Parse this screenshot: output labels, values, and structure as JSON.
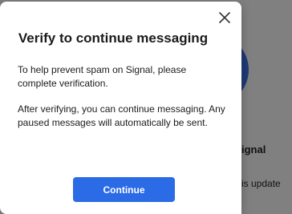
{
  "background": {
    "heading_partial": "ignal",
    "text_partial": "is update"
  },
  "dialog": {
    "title": "Verify to continue messaging",
    "paragraph1": "To help prevent spam on Signal, please complete verification.",
    "paragraph2": "After verifying, you can continue messaging. Any paused messages will automatically be sent.",
    "continue_label": "Continue",
    "close_icon": "close-icon",
    "accent_color": "#2c6be6"
  }
}
